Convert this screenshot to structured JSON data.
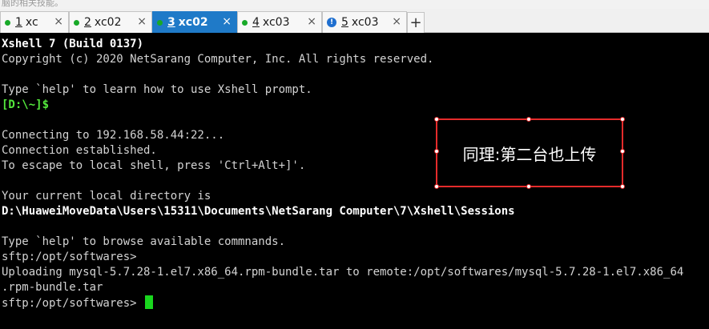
{
  "top_strip_text": "脑的相关技能。",
  "tabs": [
    {
      "num": "1",
      "name": "xc",
      "status": "green",
      "active": false
    },
    {
      "num": "2",
      "name": "xc02",
      "status": "green",
      "active": false
    },
    {
      "num": "3",
      "name": "xc02",
      "status": "green",
      "active": true
    },
    {
      "num": "4",
      "name": "xc03",
      "status": "green",
      "active": false
    },
    {
      "num": "5",
      "name": "xc03",
      "status": "warning",
      "active": false
    }
  ],
  "tab_close_glyph": "×",
  "add_tab_glyph": "+",
  "warning_glyph": "!",
  "terminal": {
    "lines": [
      {
        "text": "Xshell 7 (Build 0137)",
        "style": "bold"
      },
      {
        "text": "Copyright (c) 2020 NetSarang Computer, Inc. All rights reserved.",
        "style": "normal"
      },
      {
        "text": "",
        "style": "normal"
      },
      {
        "text": "Type `help' to learn how to use Xshell prompt.",
        "style": "normal"
      },
      {
        "text": "[D:\\~]$",
        "style": "prompt"
      },
      {
        "text": "",
        "style": "normal"
      },
      {
        "text": "Connecting to 192.168.58.44:22...",
        "style": "normal"
      },
      {
        "text": "Connection established.",
        "style": "normal"
      },
      {
        "text": "To escape to local shell, press 'Ctrl+Alt+]'.",
        "style": "normal"
      },
      {
        "text": "",
        "style": "normal"
      },
      {
        "text": "Your current local directory is",
        "style": "normal"
      },
      {
        "text": "D:\\HuaweiMoveData\\Users\\15311\\Documents\\NetSarang Computer\\7\\Xshell\\Sessions",
        "style": "bold"
      },
      {
        "text": "",
        "style": "normal"
      },
      {
        "text": "Type `help' to browse available commnands.",
        "style": "normal"
      },
      {
        "text": "sftp:/opt/softwares>",
        "style": "normal"
      },
      {
        "text": "Uploading mysql-5.7.28-1.el7.x86_64.rpm-bundle.tar to remote:/opt/softwares/mysql-5.7.28-1.el7.x86_64",
        "style": "normal"
      },
      {
        "text": ".rpm-bundle.tar",
        "style": "normal"
      },
      {
        "text": "sftp:/opt/softwares> ",
        "style": "cursor"
      }
    ]
  },
  "annotation": {
    "text": "同理:第二台也上传"
  },
  "colors": {
    "background": "#000000",
    "text": "#d3d3d3",
    "prompt_green": "#54e83c",
    "cursor_green": "#19d61e",
    "active_tab": "#1f7ac8",
    "status_green": "#18a928",
    "warning_blue": "#1f6fcf",
    "annotation_red": "#e52b2b"
  }
}
